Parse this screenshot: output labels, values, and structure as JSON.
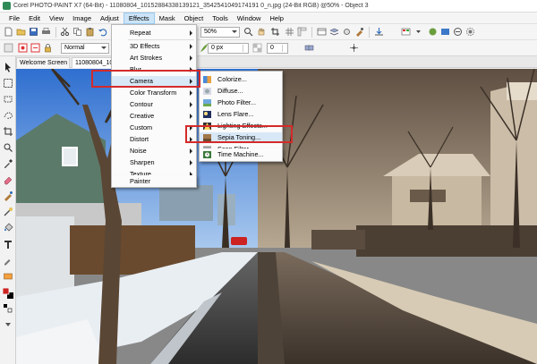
{
  "window": {
    "title": "Corel PHOTO-PAINT X7 (64-Bit) - 11080804_10152884338139121_3542541049174191 0_n.jpg (24-Bit RGB) @50% - Object 3"
  },
  "menubar": {
    "items": [
      "File",
      "Edit",
      "View",
      "Image",
      "Adjust",
      "Effects",
      "Mask",
      "Object",
      "Tools",
      "Window",
      "Help"
    ],
    "active": "Effects"
  },
  "toolbar": {
    "zoom_value": "50%",
    "opacity_value": "0",
    "px_value": "0 px",
    "merge_mode": "Normal",
    "angle_value": "0"
  },
  "tabs": {
    "welcome": "Welcome Screen",
    "image": "11080804_1015..."
  },
  "effects_menu": {
    "items": [
      {
        "label": "Repeat",
        "underline": "R",
        "submenu": true
      },
      {
        "label": "3D Effects",
        "submenu": true
      },
      {
        "label": "Art Strokes",
        "submenu": true
      },
      {
        "label": "Blur",
        "submenu": true
      },
      {
        "label": "Camera",
        "submenu": true
      },
      {
        "label": "Color Transform",
        "submenu": true
      },
      {
        "label": "Contour",
        "submenu": true
      },
      {
        "label": "Creative",
        "submenu": true
      },
      {
        "label": "Custom",
        "submenu": true
      },
      {
        "label": "Distort",
        "submenu": true
      },
      {
        "label": "Noise",
        "submenu": true
      },
      {
        "label": "Sharpen",
        "submenu": true
      },
      {
        "label": "Texture",
        "submenu": true
      },
      {
        "label": "Painter",
        "submenu": false
      }
    ]
  },
  "camera_menu": {
    "items": [
      {
        "label": "Colorize...",
        "icon": "colorize-icon"
      },
      {
        "label": "Diffuse...",
        "icon": "diffuse-icon"
      },
      {
        "label": "Photo Filter...",
        "icon": "photo-filter-icon"
      },
      {
        "label": "Lens Flare...",
        "icon": "lens-flare-icon"
      },
      {
        "label": "Lighting Effects...",
        "icon": "lighting-effects-icon"
      },
      {
        "label": "Sepia Toning...",
        "icon": "sepia-toning-icon"
      },
      {
        "label": "Scan Filter...",
        "icon": "scan-filter-icon"
      },
      {
        "label": "Time Machine...",
        "icon": "time-machine-icon"
      }
    ],
    "highlighted": "Sepia Toning..."
  },
  "colors": {
    "highlight_box": "#d42a2a",
    "menu_hover": "#d8e8f6",
    "foreground_swatch": "#cc2222",
    "background_swatch": "#000000"
  }
}
